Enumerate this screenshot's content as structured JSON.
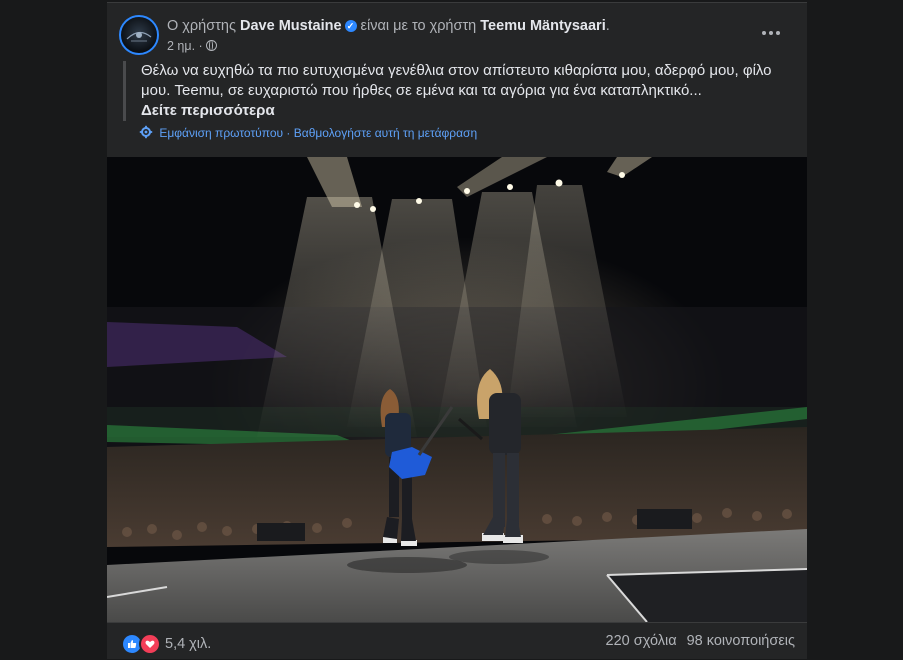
{
  "post": {
    "prefix": "Ο χρήστης",
    "author": "Dave Mustaine",
    "with_text": "είναι με το χρήστη",
    "tagged": "Teemu Mäntysaari",
    "period": ".",
    "time": "2 ημ.",
    "separator": "·",
    "text": "Θέλω να ευχηθώ τα πιο ευτυχισμένα γενέθλια στον απίστευτο κιθαρίστα μου, αδερφό μου, φίλο μου. Teemu, σε ευχαριστώ που ήρθες σε εμένα και τα αγόρια για ένα καταπληκτικό...",
    "see_more": "Δείτε περισσότερα",
    "show_original": "Εμφάνιση πρωτοτύπου",
    "translation_separator": " · ",
    "rate_translation": "Βαθμολογήστε αυτή τη μετάφραση"
  },
  "icons": {
    "verified": "verified-badge-icon",
    "privacy": "globe-icon",
    "more": "more-options-icon",
    "translation": "gear-icon",
    "like": "like-reaction-icon",
    "love": "love-reaction-icon"
  },
  "footer": {
    "reactions_count": "5,4 χιλ.",
    "comments": "220 σχόλια",
    "shares": "98 κοινοποιήσεις"
  },
  "colors": {
    "card_bg": "#242526",
    "page_bg": "#18191a",
    "link_blue": "#5ea1f8",
    "verified_blue": "#2d88ff",
    "like_blue": "#2d88ff",
    "love_red": "#f33e58",
    "guitar_blue": "#1f5bd8"
  }
}
